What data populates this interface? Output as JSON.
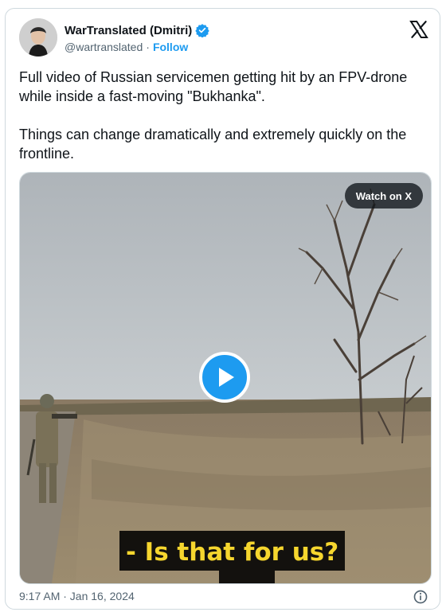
{
  "tweet": {
    "author_name": "WarTranslated (Dmitri)",
    "handle": "@wartranslated",
    "separator": "·",
    "follow_label": "Follow",
    "text_paragraphs": [
      "Full video of Russian servicemen getting hit by an FPV-drone while inside a fast-moving \"Bukhanka\".",
      "Things can change dramatically and extremely quickly on the frontline."
    ],
    "timestamp": "9:17 AM · Jan 16, 2024"
  },
  "media": {
    "watch_label": "Watch on X",
    "subtitle": "- Is that for us?"
  },
  "icons": {
    "verified": "verified-badge-icon",
    "logo": "x-logo-icon",
    "play": "play-icon",
    "info": "info-icon"
  },
  "colors": {
    "accent": "#1d9bf0",
    "subtitle_text": "#f6d62e"
  }
}
